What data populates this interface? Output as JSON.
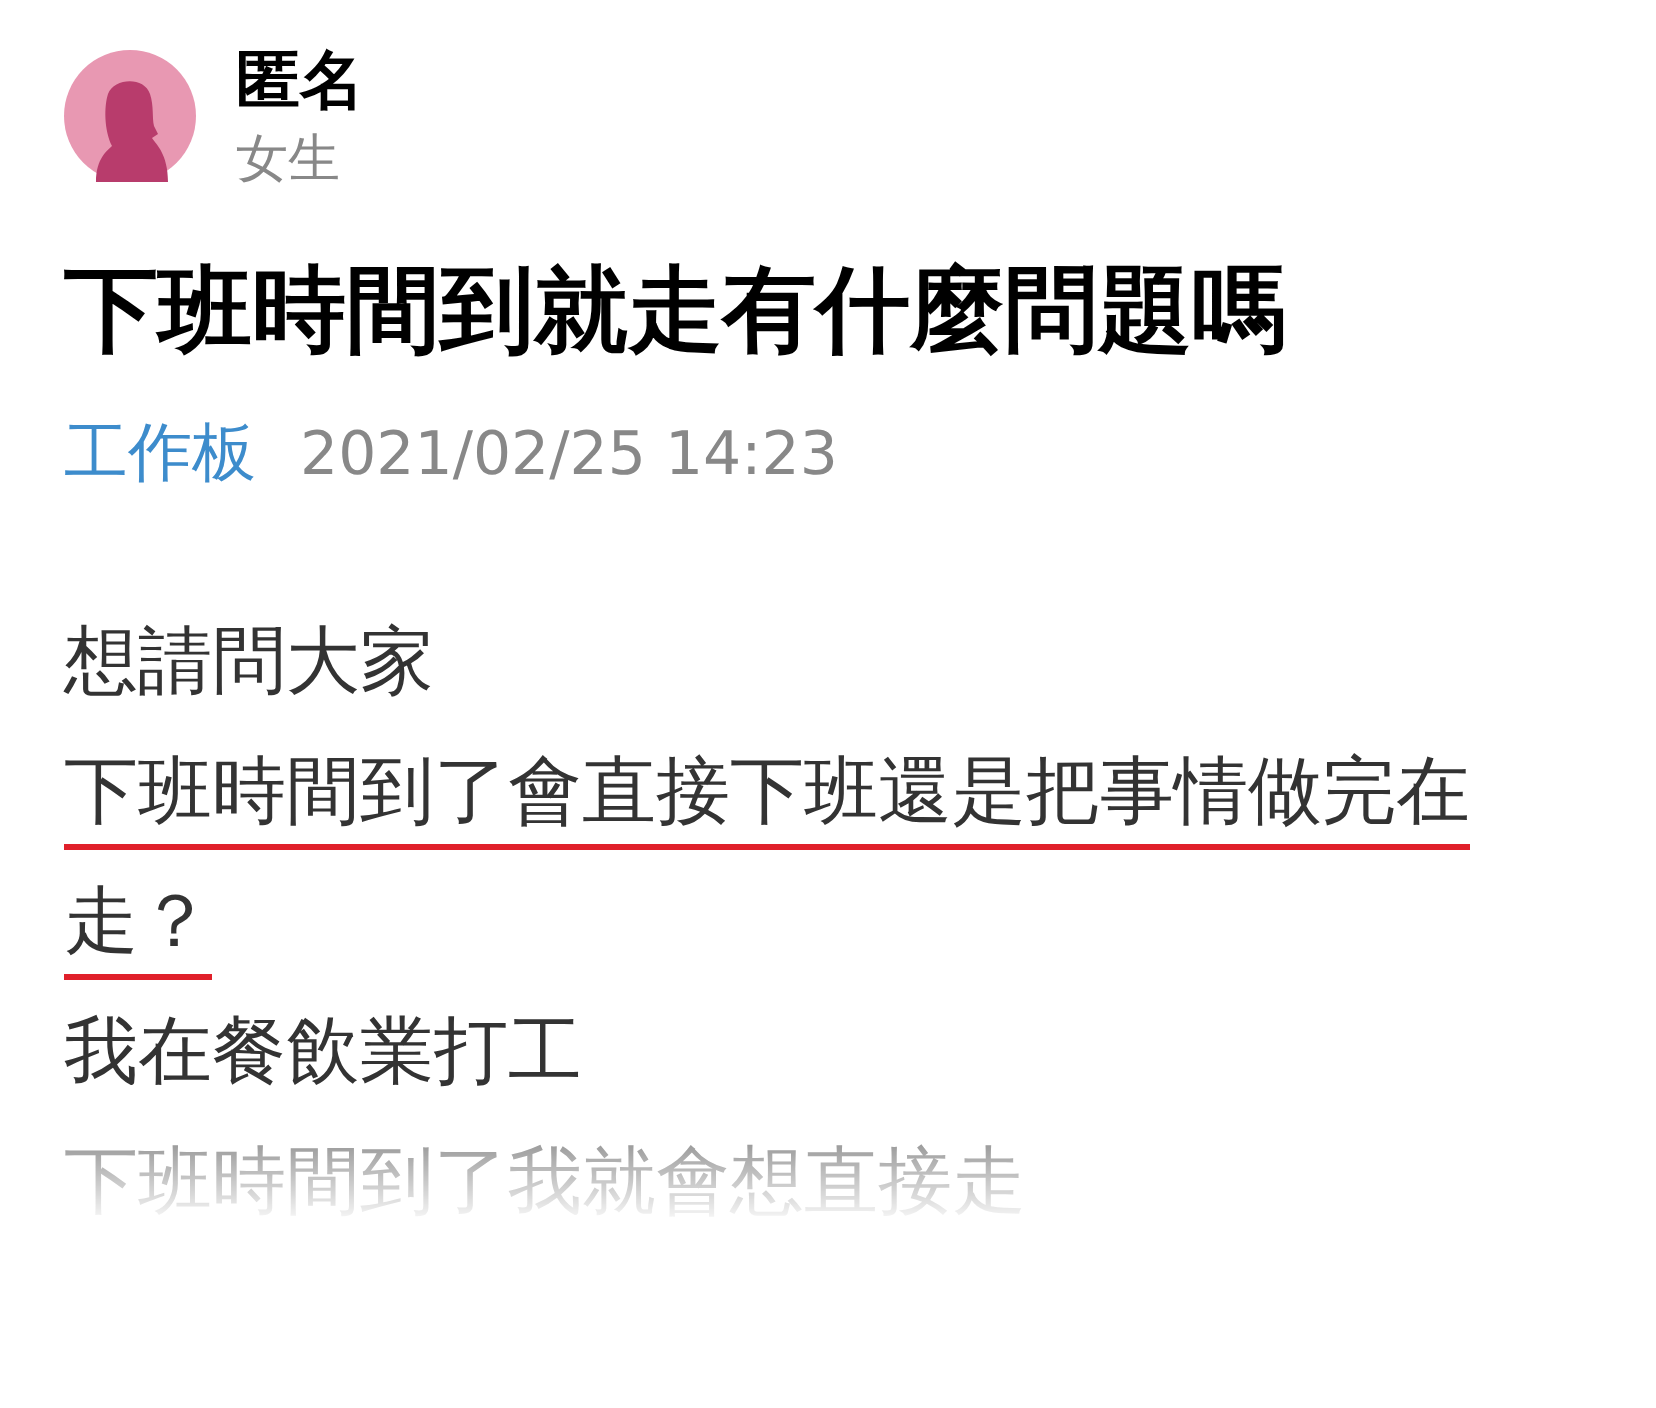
{
  "author": {
    "name": "匿名",
    "gender": "女生"
  },
  "title": "下班時間到就走有什麼問題嗎",
  "board": "工作板",
  "date": "2021/02/25 14:23",
  "body": [
    {
      "text": "想請問大家",
      "underlined": false,
      "faded": false
    },
    {
      "text": "下班時間到了會直接下班還是把事情做完在走？",
      "underlined": true,
      "faded": false
    },
    {
      "text": "我在餐飲業打工",
      "underlined": false,
      "faded": false
    },
    {
      "text": "下班時間到了我就會想直接走",
      "underlined": false,
      "faded": true
    }
  ]
}
